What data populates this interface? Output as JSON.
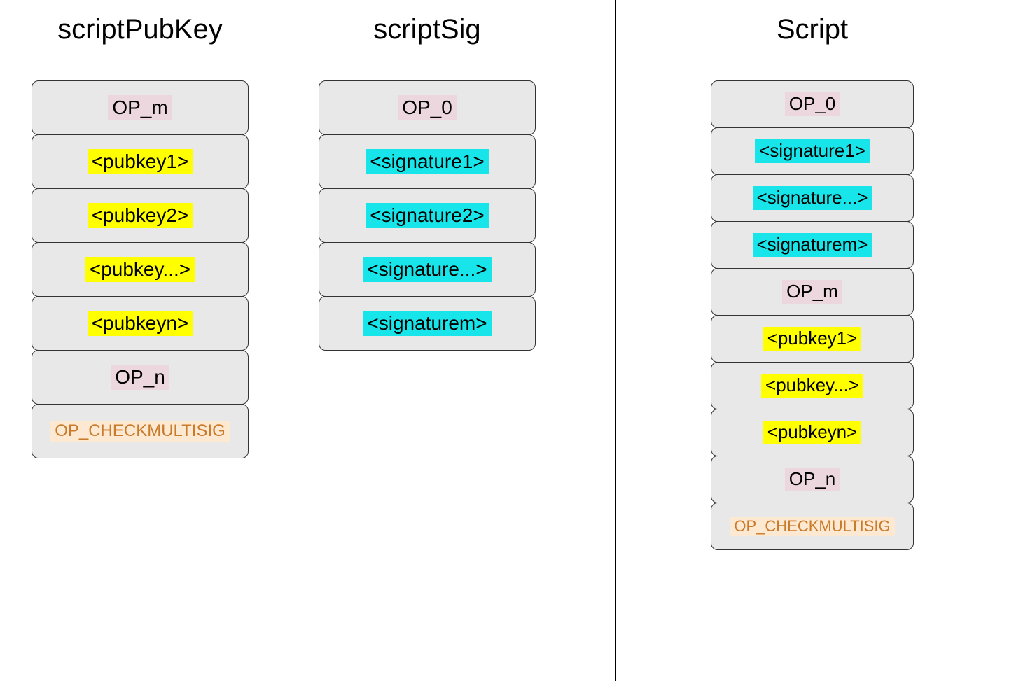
{
  "columns": {
    "scriptPubKey": {
      "title": "scriptPubKey",
      "items": [
        {
          "text": "OP_m",
          "style": "hl-pink"
        },
        {
          "text": "<pubkey1>",
          "style": "hl-yellow"
        },
        {
          "text": "<pubkey2>",
          "style": "hl-yellow"
        },
        {
          "text": "<pubkey...>",
          "style": "hl-yellow"
        },
        {
          "text": "<pubkeyn>",
          "style": "hl-yellow"
        },
        {
          "text": "OP_n",
          "style": "hl-pink"
        },
        {
          "text": "OP_CHECKMULTISIG",
          "style": "hl-orange multisig"
        }
      ]
    },
    "scriptSig": {
      "title": "scriptSig",
      "items": [
        {
          "text": "OP_0",
          "style": "hl-pink"
        },
        {
          "text": "<signature1>",
          "style": "hl-cyan"
        },
        {
          "text": "<signature2>",
          "style": "hl-cyan"
        },
        {
          "text": "<signature...>",
          "style": "hl-cyan"
        },
        {
          "text": "<signaturem>",
          "style": "hl-cyan"
        }
      ]
    },
    "script": {
      "title": "Script",
      "items": [
        {
          "text": "OP_0",
          "style": "hl-pink"
        },
        {
          "text": "<signature1>",
          "style": "hl-cyan"
        },
        {
          "text": "<signature...>",
          "style": "hl-cyan"
        },
        {
          "text": "<signaturem>",
          "style": "hl-cyan"
        },
        {
          "text": "OP_m",
          "style": "hl-pink"
        },
        {
          "text": "<pubkey1>",
          "style": "hl-yellow"
        },
        {
          "text": "<pubkey...>",
          "style": "hl-yellow"
        },
        {
          "text": "<pubkeyn>",
          "style": "hl-yellow"
        },
        {
          "text": "OP_n",
          "style": "hl-pink"
        },
        {
          "text": "OP_CHECKMULTISIG",
          "style": "hl-orange multisig"
        }
      ]
    }
  }
}
